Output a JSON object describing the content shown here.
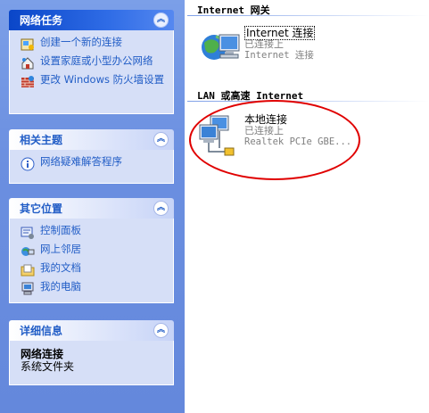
{
  "panels": {
    "network_tasks": {
      "title": "网络任务",
      "items": [
        {
          "label": "创建一个新的连接",
          "icon": "new-connection-icon"
        },
        {
          "label": "设置家庭或小型办公网络",
          "icon": "home-network-icon"
        },
        {
          "label": "更改 Windows 防火墙设置",
          "icon": "firewall-icon"
        }
      ]
    },
    "related_topics": {
      "title": "相关主题",
      "items": [
        {
          "label": "网络疑难解答程序",
          "icon": "info-icon"
        }
      ]
    },
    "other_places": {
      "title": "其它位置",
      "items": [
        {
          "label": "控制面板",
          "icon": "control-panel-icon"
        },
        {
          "label": "网上邻居",
          "icon": "network-places-icon"
        },
        {
          "label": "我的文档",
          "icon": "my-documents-icon"
        },
        {
          "label": "我的电脑",
          "icon": "my-computer-icon"
        }
      ]
    },
    "details": {
      "title": "详细信息",
      "name": "网络连接",
      "type": "系统文件夹"
    }
  },
  "groups": {
    "internet_gateway": {
      "title": "Internet 网关",
      "item": {
        "name": "Internet 连接",
        "status": "已连接上",
        "description": "Internet 连接"
      }
    },
    "lan": {
      "title": "LAN 或高速 Internet",
      "item": {
        "name": "本地连接",
        "status": "已连接上",
        "description": "Realtek PCIe GBE..."
      }
    }
  },
  "colors": {
    "task_link": "#215dc6",
    "pane_bg": "#6b8fe0",
    "highlight_ellipse": "#e00000"
  }
}
